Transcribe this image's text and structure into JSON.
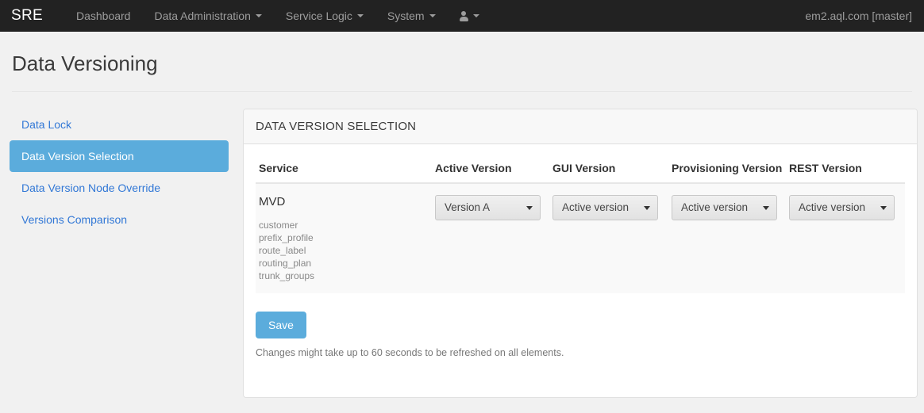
{
  "navbar": {
    "brand": "SRE",
    "items": [
      {
        "label": "Dashboard",
        "caret": false,
        "icon": ""
      },
      {
        "label": "Data Administration",
        "caret": true,
        "icon": ""
      },
      {
        "label": "Service Logic",
        "caret": true,
        "icon": ""
      },
      {
        "label": "System",
        "caret": true,
        "icon": ""
      }
    ],
    "user_menu_icon": "user-icon",
    "right_label": "em2.aql.com [master]"
  },
  "page": {
    "title": "Data Versioning"
  },
  "sidebar": {
    "items": [
      {
        "label": "Data Lock",
        "active": false
      },
      {
        "label": "Data Version Selection",
        "active": true
      },
      {
        "label": "Data Version Node Override",
        "active": false
      },
      {
        "label": "Versions Comparison",
        "active": false
      }
    ]
  },
  "panel": {
    "heading": "DATA VERSION SELECTION",
    "table": {
      "headers": [
        "Service",
        "Active Version",
        "GUI Version",
        "Provisioning Version",
        "REST Version"
      ],
      "rows": [
        {
          "service_name": "MVD",
          "service_items": [
            "customer",
            "prefix_profile",
            "route_label",
            "routing_plan",
            "trunk_groups"
          ],
          "active_version": "Version A",
          "gui_version": "Active version",
          "provisioning_version": "Active version",
          "rest_version": "Active version"
        }
      ]
    },
    "save_label": "Save",
    "help_text": "Changes might take up to 60 seconds to be refreshed on all elements."
  },
  "colors": {
    "navbar_bg": "#222222",
    "accent_blue": "#5bacdc",
    "link_blue": "#3278d6",
    "page_bg": "#f1f1f1",
    "row_bg": "#f9f9f9"
  }
}
